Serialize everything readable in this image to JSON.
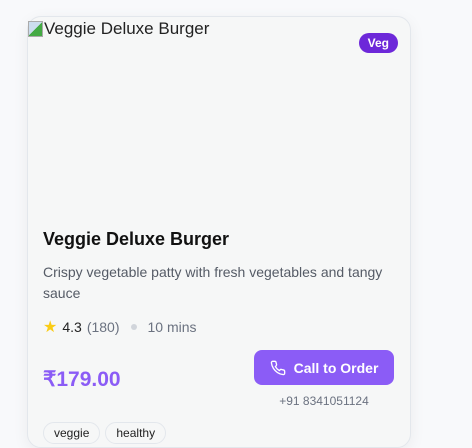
{
  "card": {
    "image_alt": "Veggie Deluxe Burger",
    "badge": "Veg",
    "title": "Veggie Deluxe Burger",
    "description": "Crispy vegetable patty with fresh vegetables and tangy sauce",
    "rating": "4.3",
    "reviews": "(180)",
    "time": "10 mins",
    "price": "₹179.00",
    "call_label": "Call to Order",
    "phone": "+91 8341051124",
    "tags": [
      "veggie",
      "healthy"
    ]
  },
  "colors": {
    "accent": "#8b5cf6",
    "badge": "#6d28d9",
    "star": "#facc15"
  }
}
